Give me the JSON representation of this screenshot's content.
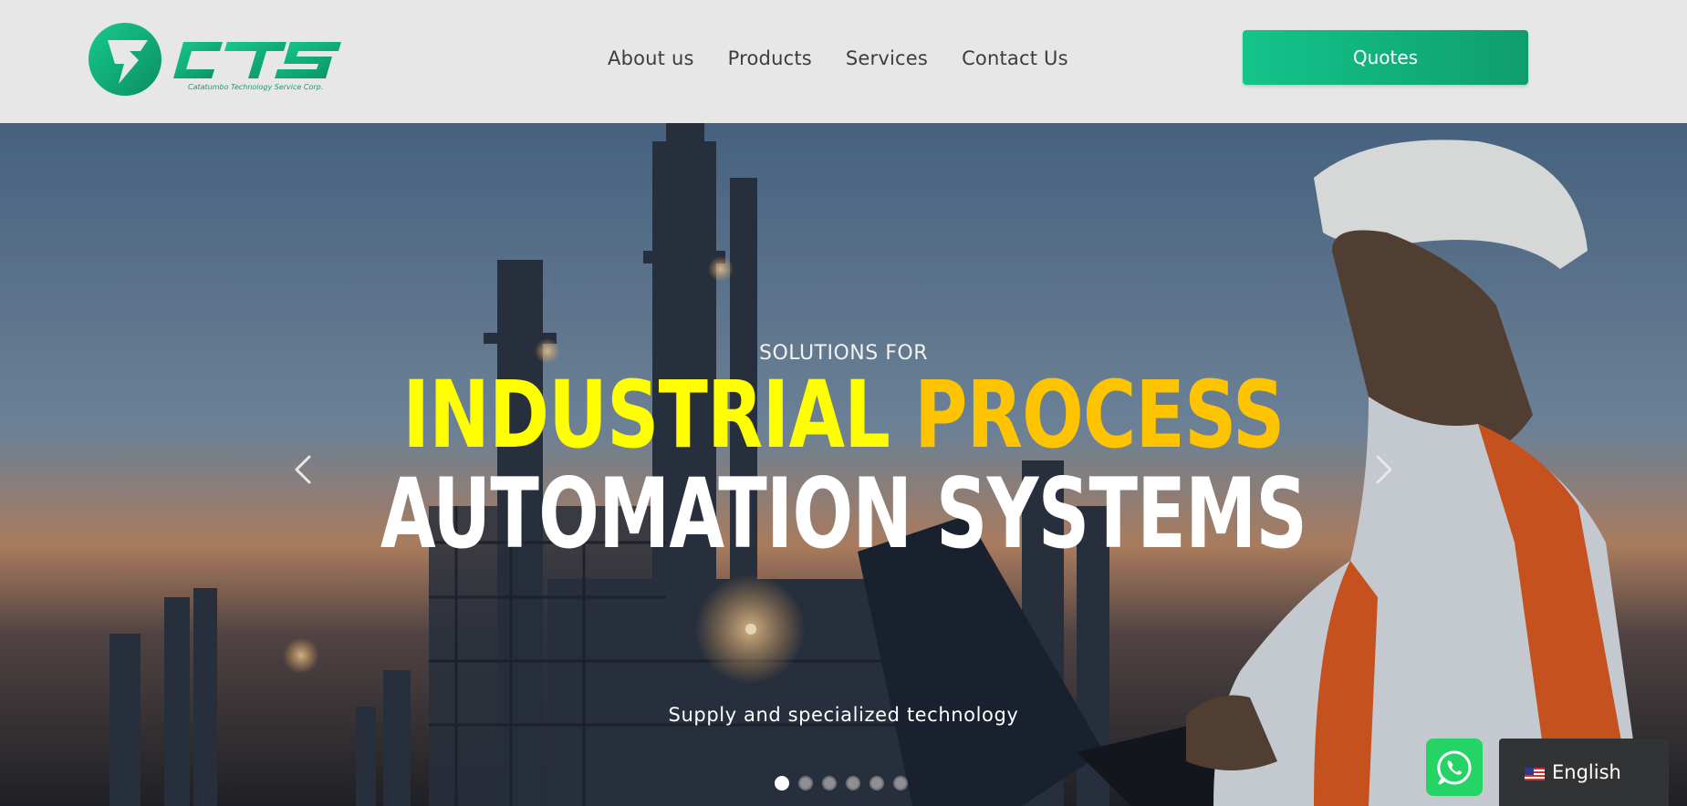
{
  "brand": {
    "name": "CTS",
    "tagline": "Catatumbo Technology Service Corp."
  },
  "nav": {
    "items": [
      "About us",
      "Products",
      "Services",
      "Contact Us"
    ]
  },
  "header": {
    "quotes_label": "Quotes"
  },
  "hero": {
    "kicker": "SOLUTIONS FOR",
    "line1_word1": "INDUSTRIAL",
    "line1_word2": "PROCESS",
    "line2": "AUTOMATION SYSTEMS",
    "subtitle": "Supply and specialized technology",
    "slide_count": 6,
    "active_slide": 1
  },
  "language": {
    "label": "English",
    "flag": "us-flag-icon"
  },
  "colors": {
    "accent": "#14c48b",
    "accent_dark": "#0f9e6d",
    "headline_yellow": "#ffff00",
    "headline_amber": "#ffc400",
    "whatsapp": "#25d366"
  }
}
